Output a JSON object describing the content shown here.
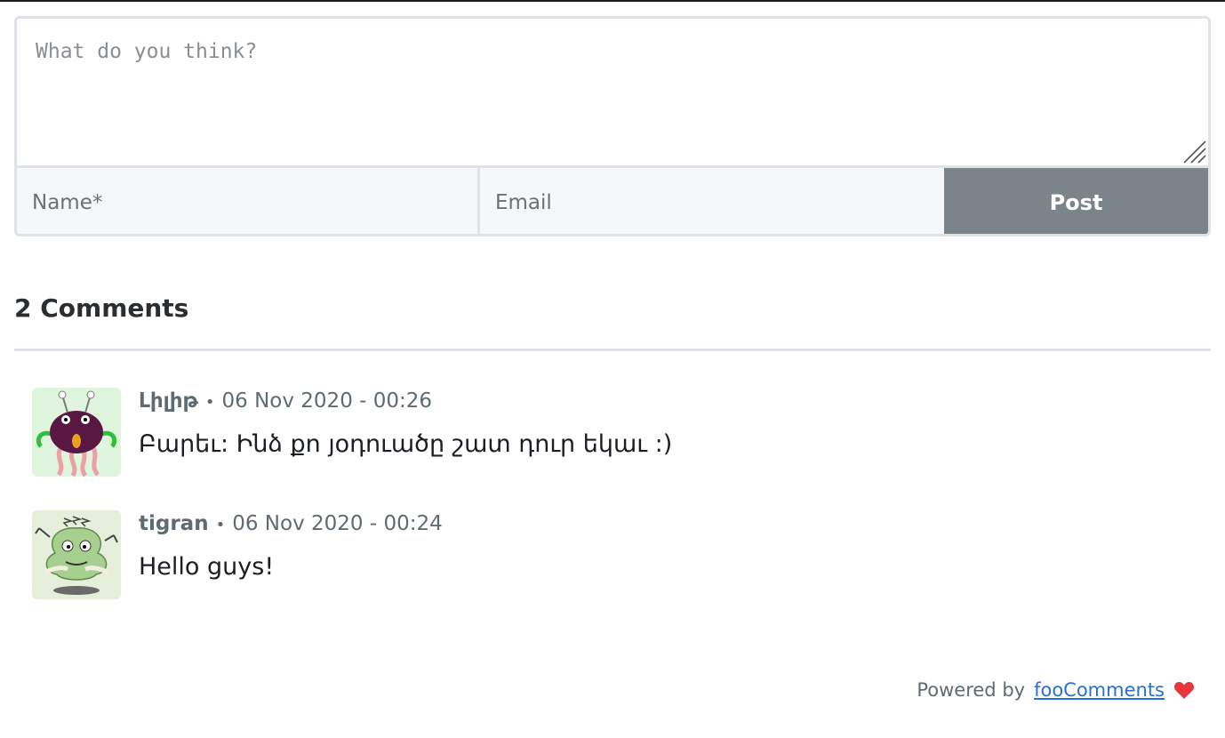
{
  "form": {
    "comment_placeholder": "What do you think?",
    "name_placeholder": "Name*",
    "email_placeholder": "Email",
    "post_label": "Post"
  },
  "comments_section": {
    "count_label": "2 Comments",
    "comments": [
      {
        "author": "Լիլիթ",
        "separator": "•",
        "date": "06 Nov 2020 - 00:26",
        "text": "Բարեւ: Ինձ քո յօդուածը շատ դուր եկաւ :)",
        "avatar_icon": "purple-monster-avatar"
      },
      {
        "author": "tigran",
        "separator": "•",
        "date": "06 Nov 2020 - 00:24",
        "text": "Hello guys!",
        "avatar_icon": "green-monster-avatar"
      }
    ]
  },
  "footer": {
    "powered_by": "Powered by",
    "brand_link": "fooComments",
    "heart_icon": "heart-icon"
  },
  "colors": {
    "post_button_bg": "#7a8489",
    "border": "#dfe2e6",
    "meta_text": "#5f6b72",
    "link": "#2b6fd6",
    "heart": "#e8363d"
  }
}
